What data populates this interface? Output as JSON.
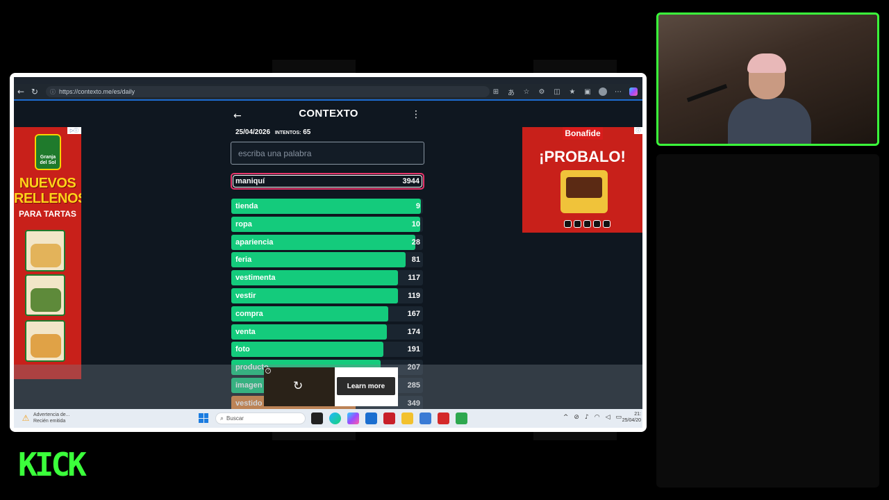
{
  "browser": {
    "url": "https://contexto.me/es/daily"
  },
  "game": {
    "title": "CONTEXTO",
    "date": "25/04/2026",
    "attempts_label": "INTENTOS:",
    "attempts": "65",
    "input_placeholder": "escriba una palabra",
    "last_guess": {
      "word": "maniquí",
      "rank": "3944"
    },
    "guesses": [
      {
        "word": "tienda",
        "rank": "9",
        "fill": 0.99,
        "color": "#14cb7c"
      },
      {
        "word": "ropa",
        "rank": "10",
        "fill": 0.985,
        "color": "#14cb7c"
      },
      {
        "word": "apariencia",
        "rank": "28",
        "fill": 0.96,
        "color": "#14cb7c"
      },
      {
        "word": "feria",
        "rank": "81",
        "fill": 0.91,
        "color": "#14cb7c"
      },
      {
        "word": "vestimenta",
        "rank": "117",
        "fill": 0.87,
        "color": "#14cb7c"
      },
      {
        "word": "vestir",
        "rank": "119",
        "fill": 0.87,
        "color": "#14cb7c"
      },
      {
        "word": "compra",
        "rank": "167",
        "fill": 0.82,
        "color": "#14cb7c"
      },
      {
        "word": "venta",
        "rank": "174",
        "fill": 0.81,
        "color": "#14cb7c"
      },
      {
        "word": "foto",
        "rank": "191",
        "fill": 0.795,
        "color": "#14cb7c"
      },
      {
        "word": "producto",
        "rank": "207",
        "fill": 0.78,
        "color": "#14cb7c"
      },
      {
        "word": "imagen",
        "rank": "285",
        "fill": 0.7,
        "color": "#14cb7c"
      },
      {
        "word": "vestido",
        "rank": "349",
        "fill": 0.65,
        "color": "#e0843a"
      }
    ]
  },
  "ads": {
    "left": {
      "brand": "Granja del Sol",
      "headline": "NUEVOS RELLENOS",
      "sub": "PARA TARTAS"
    },
    "right": {
      "brand": "Bonafide",
      "headline": "¡PROBALO!"
    },
    "video": {
      "button": "Learn more"
    }
  },
  "taskbar": {
    "notification_title": "Advertencia de...",
    "notification_sub": "Recién emitida",
    "search_placeholder": "Buscar",
    "time": "21:",
    "date": "25/04/20"
  },
  "overlay": {
    "logo": "KICK",
    "accent": "#3bff3b"
  }
}
